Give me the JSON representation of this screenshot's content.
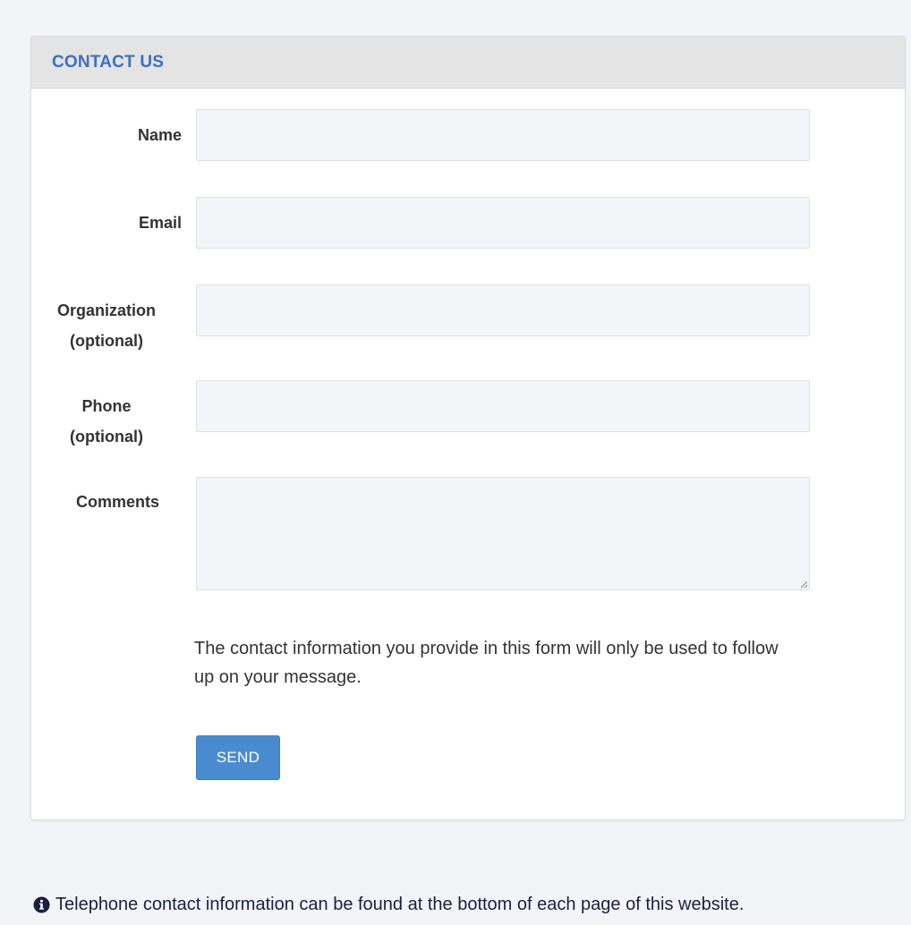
{
  "panel": {
    "title": "CONTACT US"
  },
  "form": {
    "name_label": "Name",
    "email_label": "Email",
    "organization_label_line1": "Organization",
    "organization_label_line2": "(optional)",
    "phone_label_line1": "Phone",
    "phone_label_line2": "(optional)",
    "comments_label": "Comments",
    "name_value": "",
    "email_value": "",
    "organization_value": "",
    "phone_value": "",
    "comments_value": ""
  },
  "notice_text": "The contact information you provide in this form will only be used to follow up on your message.",
  "send_label": "SEND",
  "footer_note": "Telephone contact information can be found at the bottom of each page of this website.",
  "icons": {
    "info": "info-circle-icon",
    "resize": "resize-grip-icon"
  },
  "colors": {
    "title": "#3d6fbe",
    "button": "#4a8bd0",
    "page_background": "#f3f4f8",
    "field_background": "#f4f5f9"
  }
}
